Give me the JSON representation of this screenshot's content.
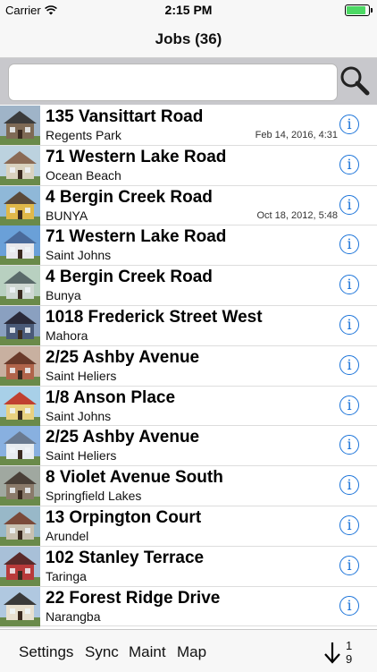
{
  "status_bar": {
    "carrier": "Carrier",
    "time": "2:15 PM",
    "battery_level": 0.95
  },
  "nav": {
    "title": "Jobs (36)"
  },
  "search": {
    "placeholder": "",
    "value": ""
  },
  "jobs": [
    {
      "address": "135 Vansittart Road",
      "suburb": "Regents Park",
      "date": "Feb 14, 2016, 4:31",
      "house": {
        "wall": "#7e6a55",
        "roof": "#3b3b3b",
        "sky": "#9fb4c8"
      }
    },
    {
      "address": "71 Western Lake Road",
      "suburb": "Ocean Beach",
      "date": "",
      "house": {
        "wall": "#d9d2bf",
        "roof": "#8a6a55",
        "sky": "#bcd2df"
      }
    },
    {
      "address": "4 Bergin Creek Road",
      "suburb": "BUNYA",
      "date": "Oct 18, 2012, 5:48",
      "house": {
        "wall": "#e0b84a",
        "roof": "#5b4a3a",
        "sky": "#8fb8d8"
      }
    },
    {
      "address": "71 Western Lake Road",
      "suburb": "Saint Johns",
      "date": "",
      "house": {
        "wall": "#e8e8ec",
        "roof": "#4a6a9a",
        "sky": "#6aa0d8"
      }
    },
    {
      "address": "4 Bergin Creek Road",
      "suburb": "Bunya",
      "date": "",
      "house": {
        "wall": "#cfd8d2",
        "roof": "#5a6a6a",
        "sky": "#b8d0c0"
      }
    },
    {
      "address": "1018 Frederick Street West",
      "suburb": "Mahora",
      "date": "",
      "house": {
        "wall": "#4a5a78",
        "roof": "#2a2a3a",
        "sky": "#8aa0c0"
      }
    },
    {
      "address": "2/25 Ashby Avenue",
      "suburb": "Saint Heliers",
      "date": "",
      "house": {
        "wall": "#b0644a",
        "roof": "#6a3a2a",
        "sky": "#c8b0a0"
      }
    },
    {
      "address": "1/8 Anson Place",
      "suburb": "Saint Johns",
      "date": "",
      "house": {
        "wall": "#e8d080",
        "roof": "#c04030",
        "sky": "#a8d0e8"
      }
    },
    {
      "address": "2/25 Ashby Avenue",
      "suburb": "Saint Heliers",
      "date": "",
      "house": {
        "wall": "#e8ecf0",
        "roof": "#6a7a90",
        "sky": "#88b0e0"
      }
    },
    {
      "address": "8 Violet Avenue South",
      "suburb": "Springfield Lakes",
      "date": "",
      "house": {
        "wall": "#8a7a6a",
        "roof": "#4a4038",
        "sky": "#a0a8a0"
      }
    },
    {
      "address": "13 Orpington Court",
      "suburb": "Arundel",
      "date": "",
      "house": {
        "wall": "#c8c0b0",
        "roof": "#7a4a3a",
        "sky": "#98b8c8"
      }
    },
    {
      "address": "102 Stanley Terrace",
      "suburb": "Taringa",
      "date": "",
      "house": {
        "wall": "#b83a3a",
        "roof": "#5a2a2a",
        "sky": "#a8c0d8"
      }
    },
    {
      "address": "22 Forest Ridge Drive",
      "suburb": "Narangba",
      "date": "",
      "house": {
        "wall": "#e8e0d0",
        "roof": "#3a3a3a",
        "sky": "#b0c8e0"
      }
    },
    {
      "address": "",
      "suburb": "",
      "date": "",
      "house": {
        "wall": "#cccccc",
        "roof": "#888888",
        "sky": "#dddddd"
      }
    }
  ],
  "toolbar": {
    "settings": "Settings",
    "sync": "Sync",
    "maint": "Maint",
    "map": "Map",
    "count_top": "1",
    "count_bottom": "9"
  },
  "colors": {
    "accent": "#1a73d9",
    "battery": "#4cd964"
  }
}
